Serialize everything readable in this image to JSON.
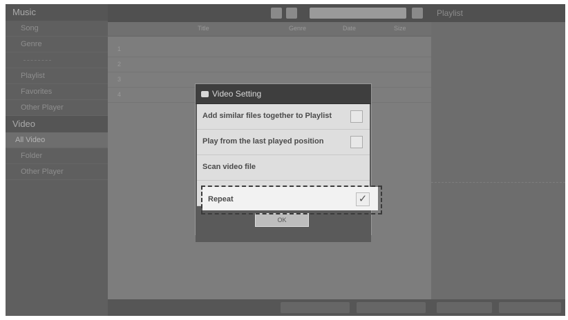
{
  "sidebar": {
    "title": "Music",
    "items": [
      "Song",
      "Genre",
      "",
      "Playlist",
      "Favorites",
      "Other Player"
    ],
    "video_heading": "Video",
    "video_items": [
      "All Video",
      "Folder",
      "Other Player"
    ]
  },
  "topbar": {
    "title": "Playlist",
    "search": ""
  },
  "table": {
    "headers": [
      "",
      "Title",
      "Genre",
      "Date",
      "Size"
    ],
    "rows": [
      {
        "num": "1",
        "title": "",
        "genre": "",
        "date": "",
        "size": ""
      },
      {
        "num": "2",
        "title": "",
        "genre": "",
        "date": "",
        "size": ""
      },
      {
        "num": "3",
        "title": "",
        "genre": "",
        "date": "",
        "size": ""
      },
      {
        "num": "4",
        "title": "",
        "genre": "",
        "date": "",
        "size": ""
      }
    ]
  },
  "footer": {
    "label": ""
  },
  "dialog": {
    "title": "Video Setting",
    "options": [
      {
        "label": "Add similar files together to Playlist",
        "checked": false
      },
      {
        "label": "Play from the last played position",
        "checked": false
      },
      {
        "label": "Scan video file"
      },
      {
        "label": "Repeat",
        "checked": true
      }
    ],
    "ok_label": "OK"
  },
  "colors": {
    "dialog_title_bg": "#3e3e3e",
    "option_bg": "#dedede",
    "dim_overlay": "#7a7a7a"
  }
}
